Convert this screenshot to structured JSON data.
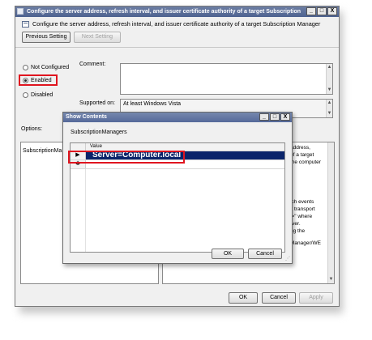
{
  "window": {
    "title": "Configure the server address, refresh interval, and issuer certificate authority of a target Subscription Manager",
    "controls": [
      "_",
      "□",
      "X"
    ]
  },
  "header": {
    "policy_text": "Configure the server address, refresh interval, and issuer certificate authority of a target Subscription Manager"
  },
  "nav": {
    "previous_label": "Previous Setting",
    "next_label": "Next Setting"
  },
  "state": {
    "options": [
      {
        "label": "Not Configured",
        "selected": false
      },
      {
        "label": "Enabled",
        "selected": true
      },
      {
        "label": "Disabled",
        "selected": false
      }
    ]
  },
  "comment_label": "Comment:",
  "supported": {
    "label": "Supported on:",
    "value": "At least Windows Vista"
  },
  "options_label": "Options:",
  "options_panel": {
    "item": "SubscriptionMa"
  },
  "help_fragments": [
    "address,",
    "of a target",
    "the computer",
    "ich events",
    "lt transport",
    "l>\" where",
    "rver.",
    "ng the",
    "Manager/WE"
  ],
  "footer": {
    "ok_label": "OK",
    "cancel_label": "Cancel",
    "apply_label": "Apply"
  },
  "dialog": {
    "title": "Show Contents",
    "controls": [
      "_",
      "□",
      "X"
    ],
    "list_label": "SubscriptionManagers",
    "column_header": "Value",
    "rows": [
      {
        "marker": "▶",
        "value": "Server=Computer.local"
      },
      {
        "marker": "✱",
        "value": ""
      }
    ],
    "ok_label": "OK",
    "cancel_label": "Cancel"
  },
  "colors": {
    "highlight_red": "#e0151f",
    "selection_blue": "#0a246a",
    "title_blue": "#4d6290"
  },
  "icons": [
    "policy-icon",
    "window-minimize-icon",
    "window-maximize-icon",
    "window-close-icon",
    "row-pointer-icon",
    "new-row-icon"
  ]
}
